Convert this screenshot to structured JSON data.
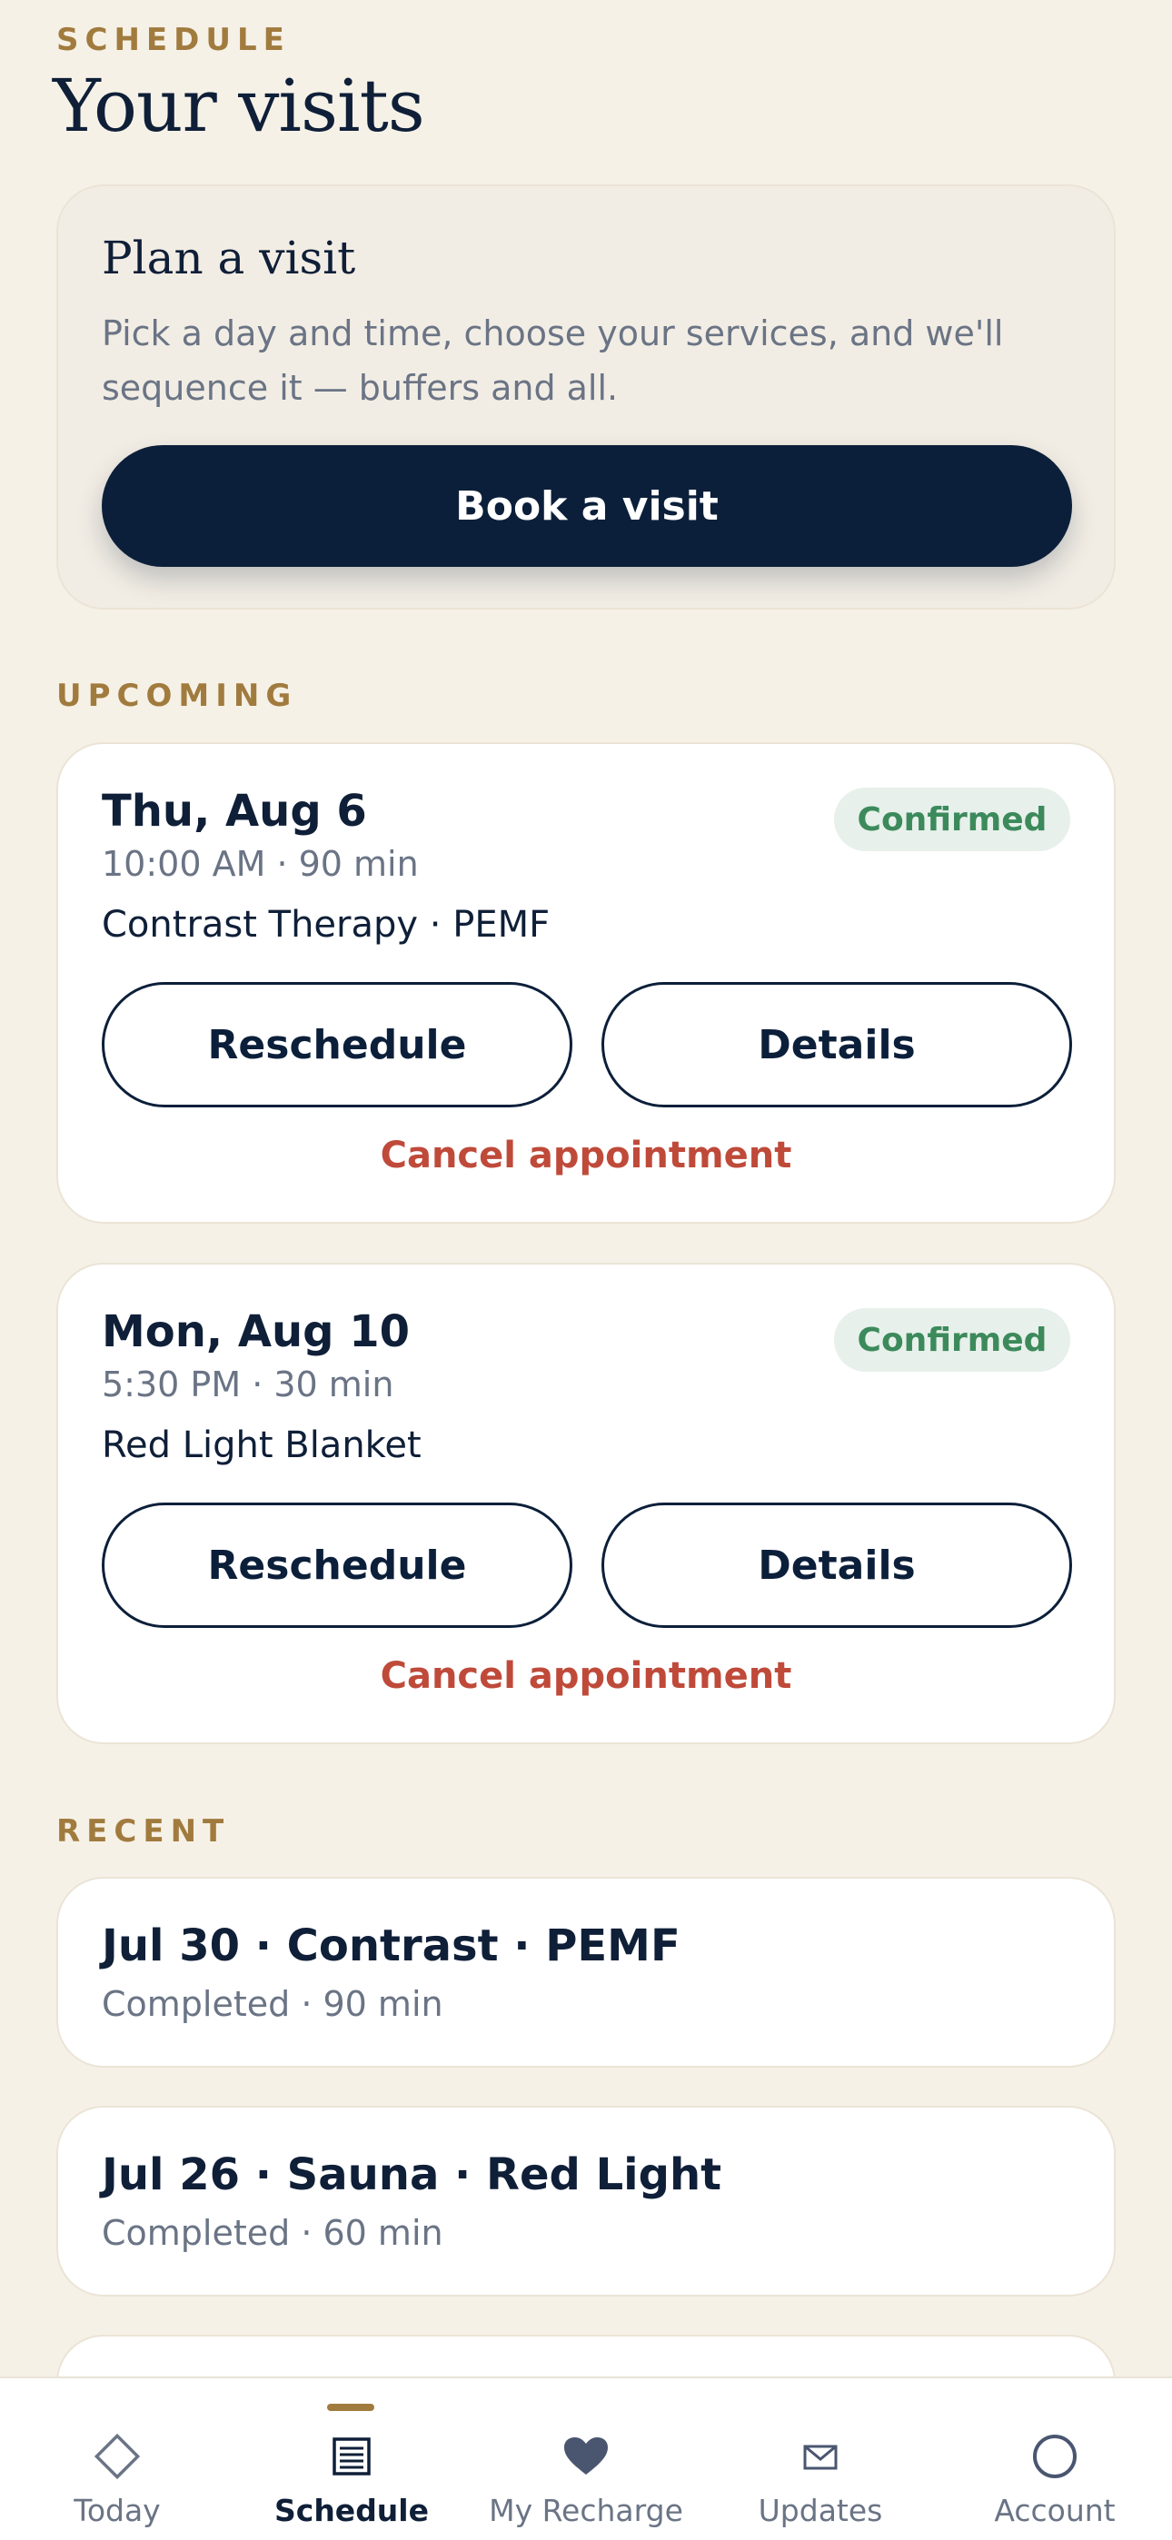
{
  "header": {
    "eyebrow": "SCHEDULE",
    "title": "Your visits"
  },
  "plan": {
    "title": "Plan a visit",
    "description": "Pick a day and time, choose your services, and we'll sequence it — buffers and all.",
    "button_label": "Book a visit"
  },
  "upcoming": {
    "heading": "UPCOMING",
    "items": [
      {
        "date": "Thu, Aug 6",
        "time": "10:00 AM · 90 min",
        "services": "Contrast Therapy · PEMF",
        "status": "Confirmed",
        "reschedule_label": "Reschedule",
        "details_label": "Details",
        "cancel_label": "Cancel appointment"
      },
      {
        "date": "Mon, Aug 10",
        "time": "5:30 PM · 30 min",
        "services": "Red Light Blanket",
        "status": "Confirmed",
        "reschedule_label": "Reschedule",
        "details_label": "Details",
        "cancel_label": "Cancel appointment"
      }
    ]
  },
  "recent": {
    "heading": "RECENT",
    "items": [
      {
        "title": "Jul 30 · Contrast · PEMF",
        "subtitle": "Completed · 90 min"
      },
      {
        "title": "Jul 26 · Sauna · Red Light",
        "subtitle": "Completed · 60 min"
      }
    ]
  },
  "tabbar": {
    "active": "Schedule",
    "tabs": [
      {
        "label": "Today",
        "icon": "diamond-icon"
      },
      {
        "label": "Schedule",
        "icon": "schedule-list-icon"
      },
      {
        "label": "My Recharge",
        "icon": "heart-icon"
      },
      {
        "label": "Updates",
        "icon": "envelope-icon"
      },
      {
        "label": "Account",
        "icon": "account-circle-icon"
      }
    ]
  },
  "colors": {
    "background": "#f6f1e7",
    "accent_gold": "#a17b3e",
    "navy": "#0c1f3a",
    "confirmed_green": "#3c8a5c",
    "cancel_red": "#bf4a3a"
  }
}
